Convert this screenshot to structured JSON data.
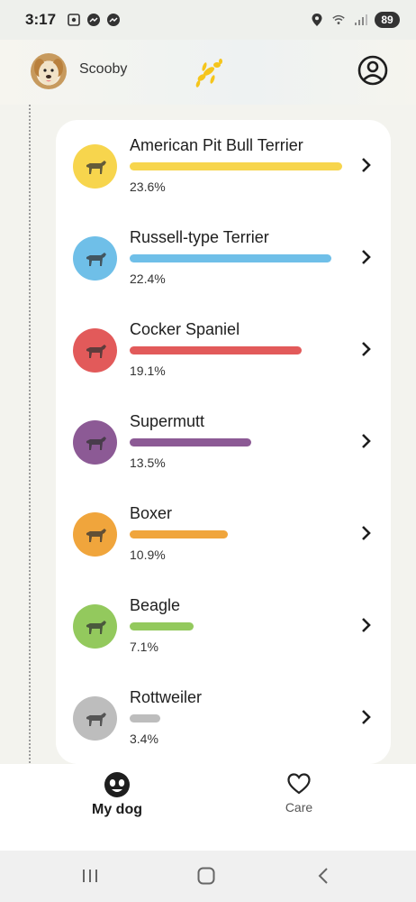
{
  "status_bar": {
    "time": "3:17",
    "battery": "89",
    "left_icons": [
      "screenshot-icon",
      "messenger-icon",
      "messenger-icon"
    ],
    "right_icons": [
      "location-icon",
      "wifi-icon",
      "signal-icon"
    ]
  },
  "header": {
    "user_name": "Scooby",
    "logo_icon": "dog-balloon-logo",
    "logo_color": "#f5c51c"
  },
  "breeds": [
    {
      "name": "American Pit Bull Terrier",
      "percent": "23.6%",
      "value": 23.6,
      "color": "#f7d54d"
    },
    {
      "name": "Russell-type Terrier",
      "percent": "22.4%",
      "value": 22.4,
      "color": "#6fbfe8"
    },
    {
      "name": "Cocker Spaniel",
      "percent": "19.1%",
      "value": 19.1,
      "color": "#e25a5a"
    },
    {
      "name": "Supermutt",
      "percent": "13.5%",
      "value": 13.5,
      "color": "#8c5a95"
    },
    {
      "name": "Boxer",
      "percent": "10.9%",
      "value": 10.9,
      "color": "#f0a53c"
    },
    {
      "name": "Beagle",
      "percent": "7.1%",
      "value": 7.1,
      "color": "#93c95d"
    },
    {
      "name": "Rottweiler",
      "percent": "3.4%",
      "value": 3.4,
      "color": "#bdbdbd"
    }
  ],
  "bottom_nav": {
    "my_dog": "My dog",
    "care": "Care"
  }
}
